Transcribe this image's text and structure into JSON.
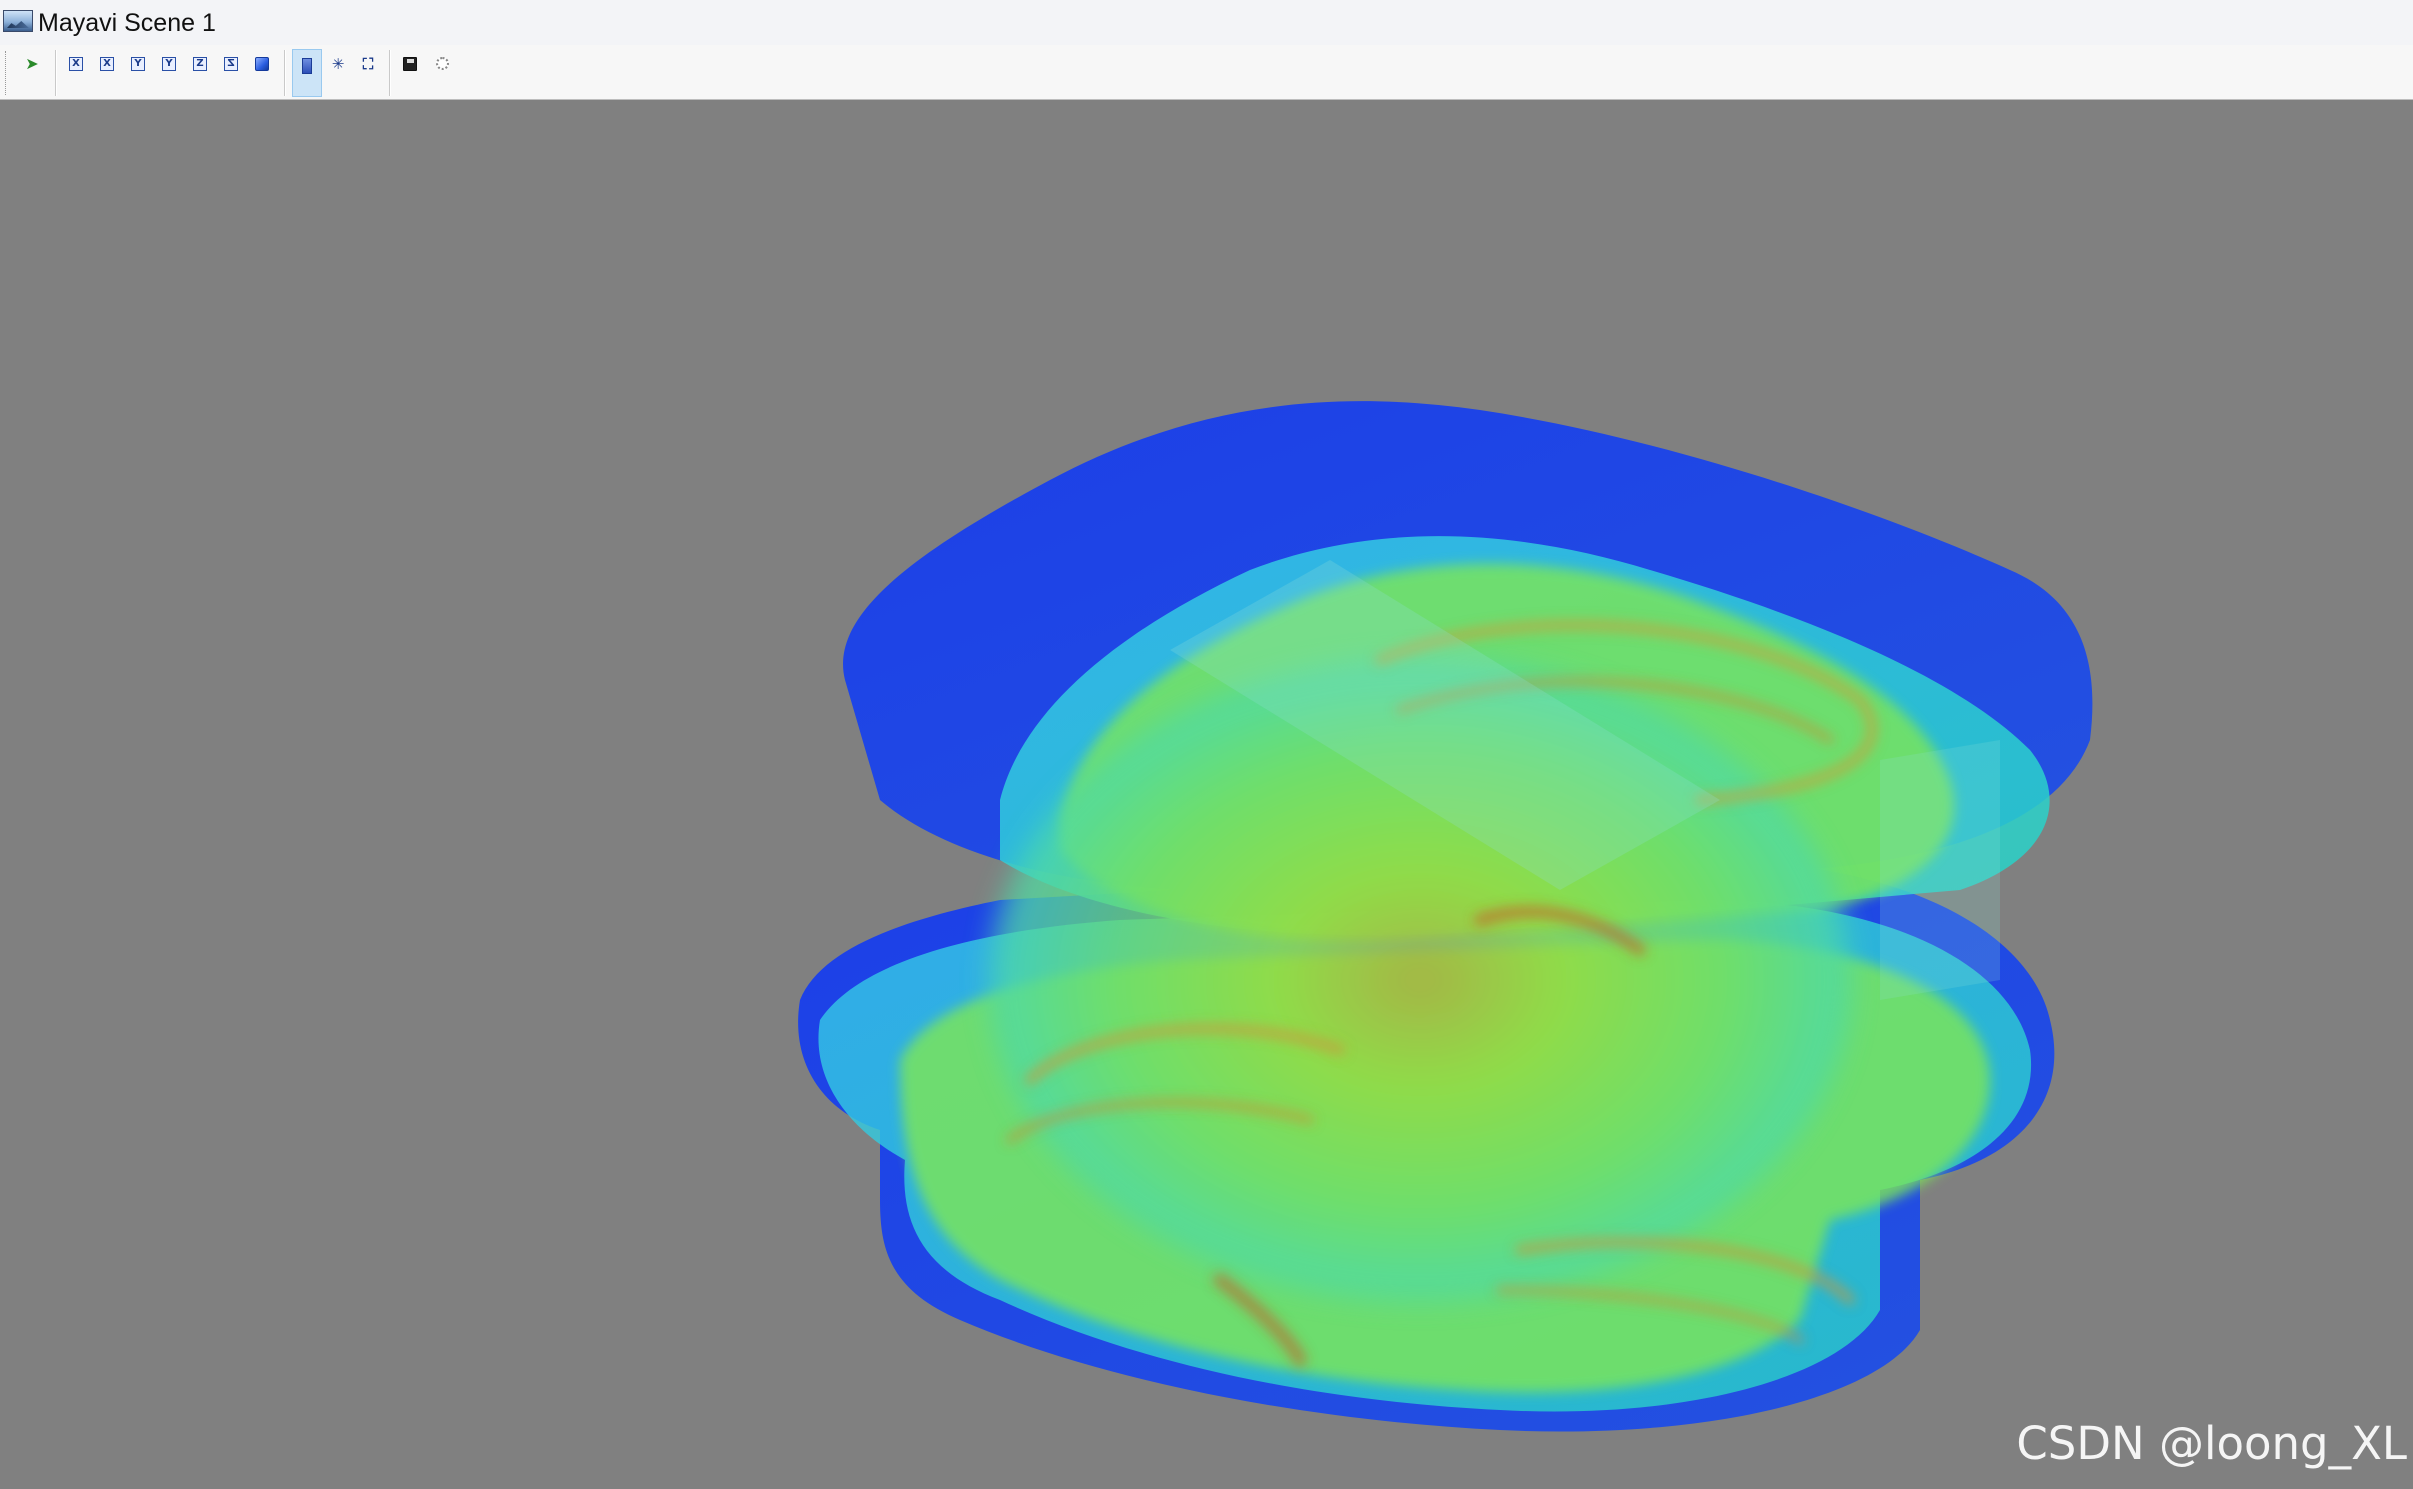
{
  "window": {
    "title": "Mayavi Scene 1"
  },
  "toolbar": {
    "buttons": [
      {
        "name": "pick-icon",
        "glyph": "➤"
      },
      {
        "name": "view-plus-x",
        "glyph": "X"
      },
      {
        "name": "view-minus-x",
        "glyph": "X"
      },
      {
        "name": "view-plus-y",
        "glyph": "Y"
      },
      {
        "name": "view-minus-y",
        "glyph": "Y"
      },
      {
        "name": "view-plus-z",
        "glyph": "Z"
      },
      {
        "name": "view-minus-z",
        "glyph": "Z"
      },
      {
        "name": "isometric-view-icon",
        "glyph": ""
      },
      {
        "name": "stereo-toggle-icon",
        "glyph": ""
      },
      {
        "name": "axes-toggle-icon",
        "glyph": "✳"
      },
      {
        "name": "full-screen-icon",
        "glyph": "⛶"
      },
      {
        "name": "save-icon",
        "glyph": ""
      },
      {
        "name": "configure-icon",
        "glyph": ""
      }
    ]
  },
  "scene": {
    "colors": {
      "background": "#808080",
      "outer": "#1f45e6",
      "mid": "#2fd0e0",
      "inner": "#7fe84a",
      "core": "#c8b040",
      "hot": "#c65a28"
    }
  },
  "watermark": {
    "text": "CSDN @loong_XL"
  }
}
